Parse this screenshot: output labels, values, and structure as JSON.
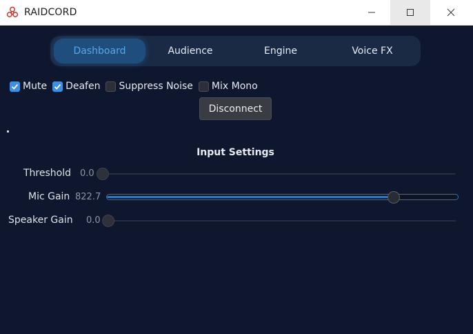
{
  "window": {
    "title": "RAIDCORD",
    "controls": [
      "minimize",
      "maximize",
      "close"
    ]
  },
  "tabs": [
    {
      "label": "Dashboard",
      "active": true
    },
    {
      "label": "Audience",
      "active": false
    },
    {
      "label": "Engine",
      "active": false
    },
    {
      "label": "Voice FX",
      "active": false
    }
  ],
  "options": [
    {
      "label": "Mute",
      "checked": true
    },
    {
      "label": "Deafen",
      "checked": true
    },
    {
      "label": "Suppress Noise",
      "checked": false
    },
    {
      "label": "Mix Mono",
      "checked": false
    }
  ],
  "disconnect_label": "Disconnect",
  "input_settings": {
    "title": "Input Settings",
    "sliders": [
      {
        "label": "Threshold",
        "value": "0.0",
        "fraction": 0.0
      },
      {
        "label": "Mic Gain",
        "value": "822.7",
        "fraction": 0.82
      },
      {
        "label": "Speaker Gain",
        "value": "0.0",
        "fraction": 0.0
      }
    ]
  },
  "colors": {
    "background": "#0f172e",
    "accent": "#3d8fe0",
    "tab_active_text": "#57a8ea"
  },
  "icons": {
    "app": "biohazard-icon"
  }
}
